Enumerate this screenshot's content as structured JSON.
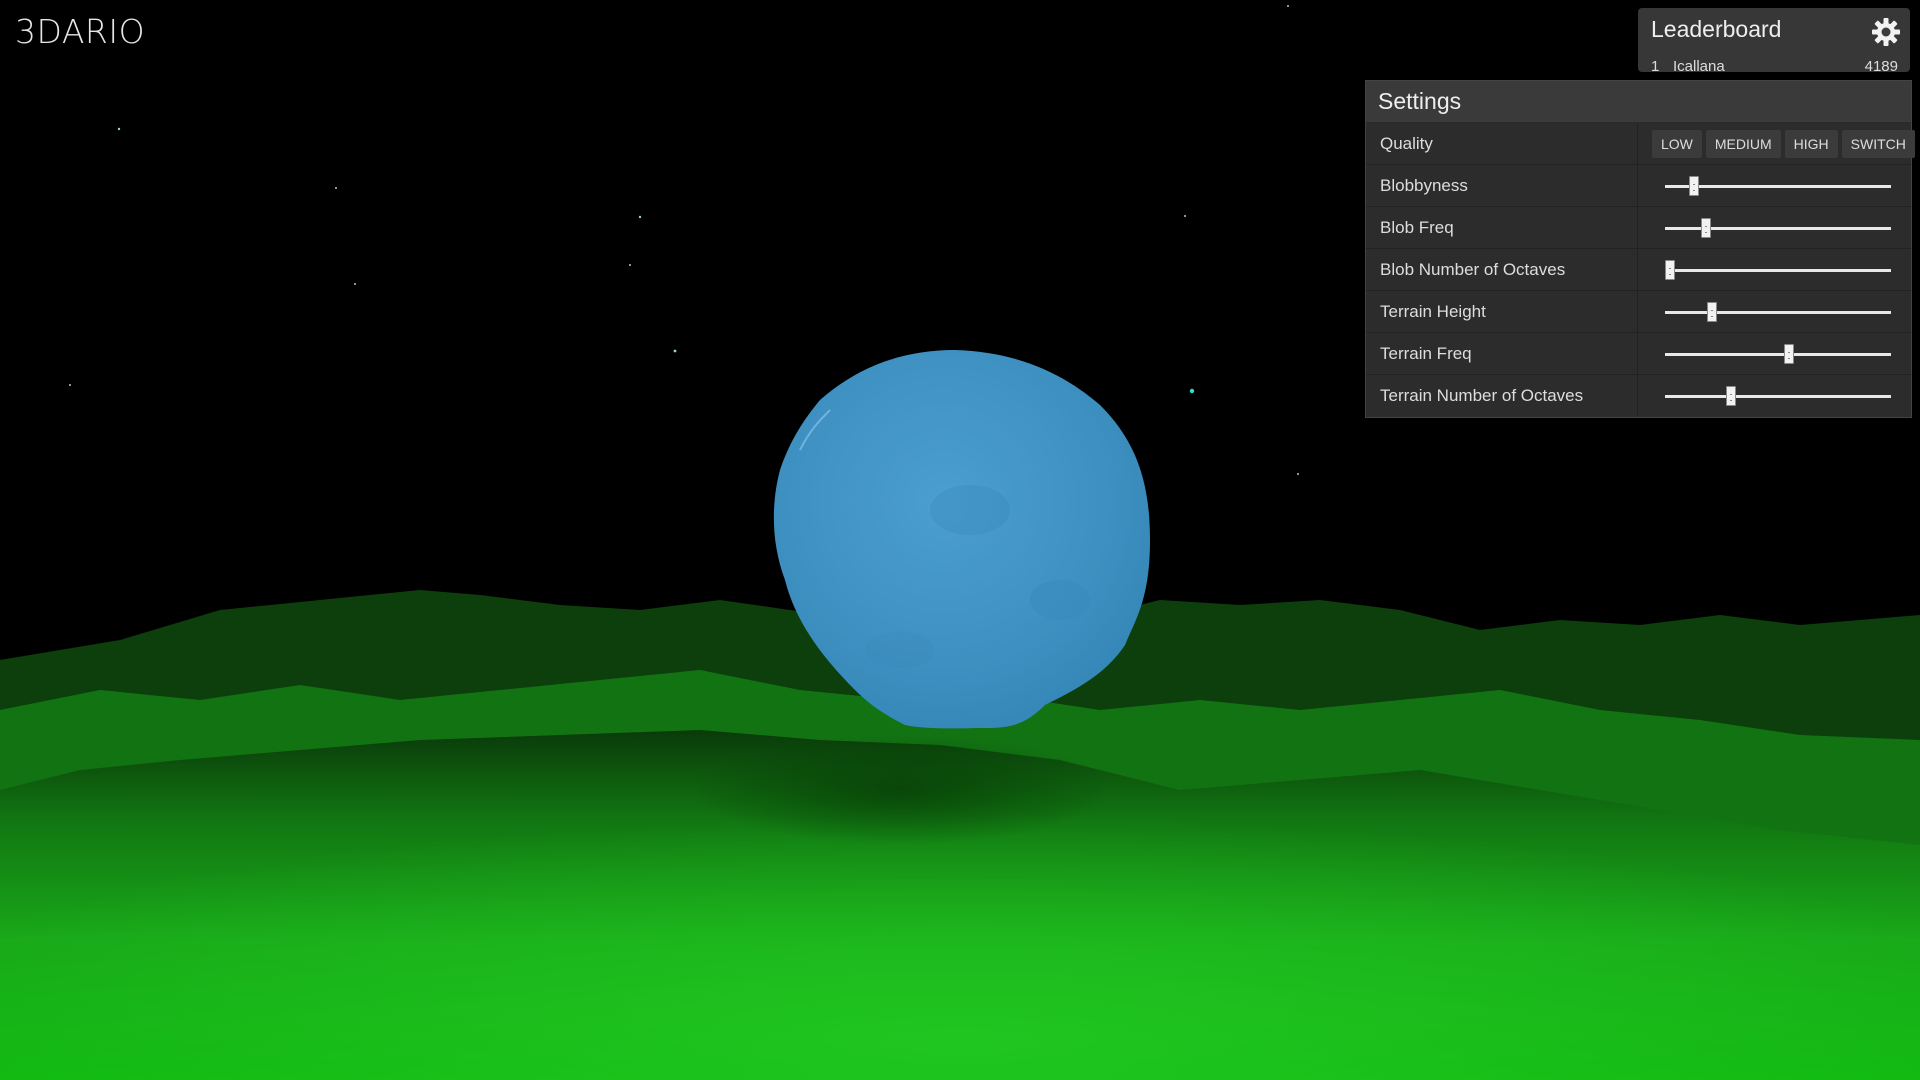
{
  "app": {
    "title": "3DARIO"
  },
  "leaderboard": {
    "title": "Leaderboard",
    "entries": [
      {
        "rank": "1",
        "name": "Icallana",
        "score": "4189"
      }
    ]
  },
  "settings": {
    "title": "Settings",
    "quality": {
      "label": "Quality",
      "options": [
        "LOW",
        "MEDIUM",
        "HIGH",
        "SWITCH"
      ]
    },
    "sliders": [
      {
        "label": "Blobbyness",
        "value": 0.13
      },
      {
        "label": "Blob Freq",
        "value": 0.18
      },
      {
        "label": "Blob Number of Octaves",
        "value": 0.02
      },
      {
        "label": "Terrain Height",
        "value": 0.21
      },
      {
        "label": "Terrain Freq",
        "value": 0.55
      },
      {
        "label": "Terrain Number of Octaves",
        "value": 0.29
      }
    ]
  },
  "colors": {
    "sky": "#000000",
    "terrain": "#1cb81c",
    "blob": "#3f94c4",
    "panel": "#2d2d2d"
  }
}
